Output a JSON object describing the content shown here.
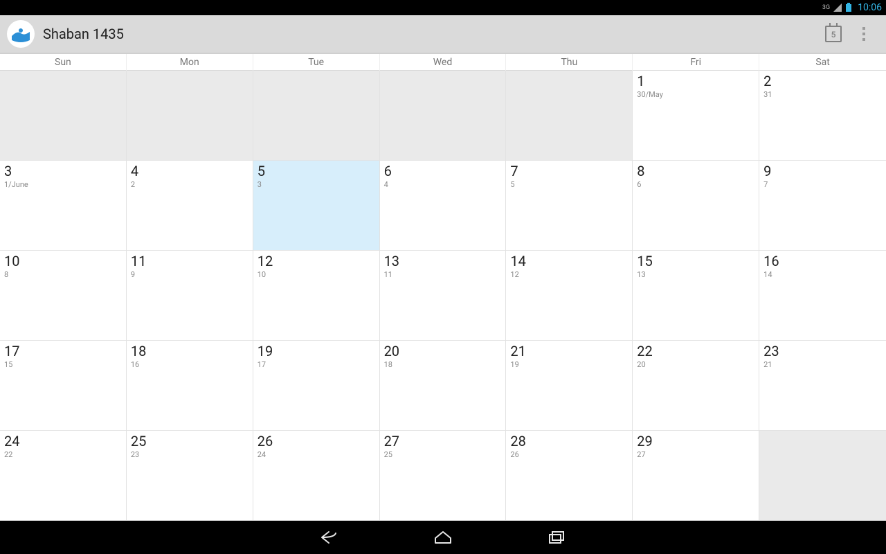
{
  "status": {
    "network_label": "3G",
    "clock": "10:06"
  },
  "actionbar": {
    "title": "Shaban 1435",
    "today_badge": "5"
  },
  "weekdays": [
    "Sun",
    "Mon",
    "Tue",
    "Wed",
    "Thu",
    "Fri",
    "Sat"
  ],
  "grid": [
    {
      "blank": true
    },
    {
      "blank": true
    },
    {
      "blank": true
    },
    {
      "blank": true
    },
    {
      "blank": true
    },
    {
      "primary": "1",
      "secondary": "30/May"
    },
    {
      "primary": "2",
      "secondary": "31"
    },
    {
      "primary": "3",
      "secondary": "1/June"
    },
    {
      "primary": "4",
      "secondary": "2"
    },
    {
      "primary": "5",
      "secondary": "3",
      "today": true
    },
    {
      "primary": "6",
      "secondary": "4"
    },
    {
      "primary": "7",
      "secondary": "5"
    },
    {
      "primary": "8",
      "secondary": "6"
    },
    {
      "primary": "9",
      "secondary": "7"
    },
    {
      "primary": "10",
      "secondary": "8"
    },
    {
      "primary": "11",
      "secondary": "9"
    },
    {
      "primary": "12",
      "secondary": "10"
    },
    {
      "primary": "13",
      "secondary": "11"
    },
    {
      "primary": "14",
      "secondary": "12"
    },
    {
      "primary": "15",
      "secondary": "13"
    },
    {
      "primary": "16",
      "secondary": "14"
    },
    {
      "primary": "17",
      "secondary": "15"
    },
    {
      "primary": "18",
      "secondary": "16"
    },
    {
      "primary": "19",
      "secondary": "17"
    },
    {
      "primary": "20",
      "secondary": "18"
    },
    {
      "primary": "21",
      "secondary": "19"
    },
    {
      "primary": "22",
      "secondary": "20"
    },
    {
      "primary": "23",
      "secondary": "21"
    },
    {
      "primary": "24",
      "secondary": "22"
    },
    {
      "primary": "25",
      "secondary": "23"
    },
    {
      "primary": "26",
      "secondary": "24"
    },
    {
      "primary": "27",
      "secondary": "25"
    },
    {
      "primary": "28",
      "secondary": "26"
    },
    {
      "primary": "29",
      "secondary": "27"
    },
    {
      "blank": true
    }
  ]
}
